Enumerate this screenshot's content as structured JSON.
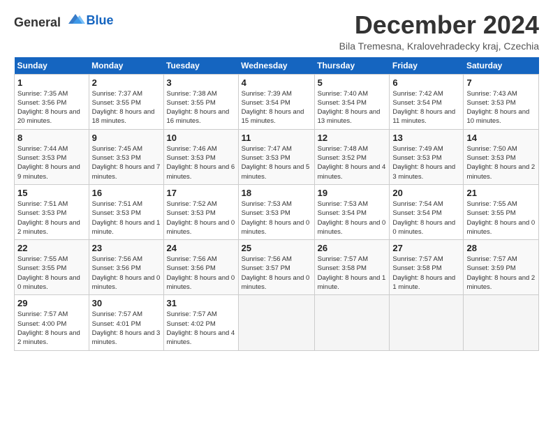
{
  "header": {
    "logo_general": "General",
    "logo_blue": "Blue",
    "title": "December 2024",
    "subtitle": "Bila Tremesna, Kralovehradecky kraj, Czechia"
  },
  "calendar": {
    "weekdays": [
      "Sunday",
      "Monday",
      "Tuesday",
      "Wednesday",
      "Thursday",
      "Friday",
      "Saturday"
    ],
    "weeks": [
      [
        {
          "day": "1",
          "sunrise": "7:35 AM",
          "sunset": "3:56 PM",
          "daylight": "8 hours and 20 minutes."
        },
        {
          "day": "2",
          "sunrise": "7:37 AM",
          "sunset": "3:55 PM",
          "daylight": "8 hours and 18 minutes."
        },
        {
          "day": "3",
          "sunrise": "7:38 AM",
          "sunset": "3:55 PM",
          "daylight": "8 hours and 16 minutes."
        },
        {
          "day": "4",
          "sunrise": "7:39 AM",
          "sunset": "3:54 PM",
          "daylight": "8 hours and 15 minutes."
        },
        {
          "day": "5",
          "sunrise": "7:40 AM",
          "sunset": "3:54 PM",
          "daylight": "8 hours and 13 minutes."
        },
        {
          "day": "6",
          "sunrise": "7:42 AM",
          "sunset": "3:54 PM",
          "daylight": "8 hours and 11 minutes."
        },
        {
          "day": "7",
          "sunrise": "7:43 AM",
          "sunset": "3:53 PM",
          "daylight": "8 hours and 10 minutes."
        }
      ],
      [
        {
          "day": "8",
          "sunrise": "7:44 AM",
          "sunset": "3:53 PM",
          "daylight": "8 hours and 9 minutes."
        },
        {
          "day": "9",
          "sunrise": "7:45 AM",
          "sunset": "3:53 PM",
          "daylight": "8 hours and 7 minutes."
        },
        {
          "day": "10",
          "sunrise": "7:46 AM",
          "sunset": "3:53 PM",
          "daylight": "8 hours and 6 minutes."
        },
        {
          "day": "11",
          "sunrise": "7:47 AM",
          "sunset": "3:53 PM",
          "daylight": "8 hours and 5 minutes."
        },
        {
          "day": "12",
          "sunrise": "7:48 AM",
          "sunset": "3:52 PM",
          "daylight": "8 hours and 4 minutes."
        },
        {
          "day": "13",
          "sunrise": "7:49 AM",
          "sunset": "3:53 PM",
          "daylight": "8 hours and 3 minutes."
        },
        {
          "day": "14",
          "sunrise": "7:50 AM",
          "sunset": "3:53 PM",
          "daylight": "8 hours and 2 minutes."
        }
      ],
      [
        {
          "day": "15",
          "sunrise": "7:51 AM",
          "sunset": "3:53 PM",
          "daylight": "8 hours and 2 minutes."
        },
        {
          "day": "16",
          "sunrise": "7:51 AM",
          "sunset": "3:53 PM",
          "daylight": "8 hours and 1 minute."
        },
        {
          "day": "17",
          "sunrise": "7:52 AM",
          "sunset": "3:53 PM",
          "daylight": "8 hours and 0 minutes."
        },
        {
          "day": "18",
          "sunrise": "7:53 AM",
          "sunset": "3:53 PM",
          "daylight": "8 hours and 0 minutes."
        },
        {
          "day": "19",
          "sunrise": "7:53 AM",
          "sunset": "3:54 PM",
          "daylight": "8 hours and 0 minutes."
        },
        {
          "day": "20",
          "sunrise": "7:54 AM",
          "sunset": "3:54 PM",
          "daylight": "8 hours and 0 minutes."
        },
        {
          "day": "21",
          "sunrise": "7:55 AM",
          "sunset": "3:55 PM",
          "daylight": "8 hours and 0 minutes."
        }
      ],
      [
        {
          "day": "22",
          "sunrise": "7:55 AM",
          "sunset": "3:55 PM",
          "daylight": "8 hours and 0 minutes."
        },
        {
          "day": "23",
          "sunrise": "7:56 AM",
          "sunset": "3:56 PM",
          "daylight": "8 hours and 0 minutes."
        },
        {
          "day": "24",
          "sunrise": "7:56 AM",
          "sunset": "3:56 PM",
          "daylight": "8 hours and 0 minutes."
        },
        {
          "day": "25",
          "sunrise": "7:56 AM",
          "sunset": "3:57 PM",
          "daylight": "8 hours and 0 minutes."
        },
        {
          "day": "26",
          "sunrise": "7:57 AM",
          "sunset": "3:58 PM",
          "daylight": "8 hours and 1 minute."
        },
        {
          "day": "27",
          "sunrise": "7:57 AM",
          "sunset": "3:58 PM",
          "daylight": "8 hours and 1 minute."
        },
        {
          "day": "28",
          "sunrise": "7:57 AM",
          "sunset": "3:59 PM",
          "daylight": "8 hours and 2 minutes."
        }
      ],
      [
        {
          "day": "29",
          "sunrise": "7:57 AM",
          "sunset": "4:00 PM",
          "daylight": "8 hours and 2 minutes."
        },
        {
          "day": "30",
          "sunrise": "7:57 AM",
          "sunset": "4:01 PM",
          "daylight": "8 hours and 3 minutes."
        },
        {
          "day": "31",
          "sunrise": "7:57 AM",
          "sunset": "4:02 PM",
          "daylight": "8 hours and 4 minutes."
        },
        null,
        null,
        null,
        null
      ]
    ]
  }
}
